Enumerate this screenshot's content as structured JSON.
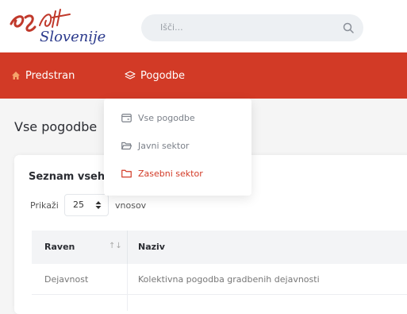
{
  "brand": {
    "logo_numeral": "30 let",
    "logo_word": "Slovenije",
    "logo_color": "#c0392b"
  },
  "search": {
    "placeholder": "Išči..."
  },
  "nav": {
    "home_label": "Predstran",
    "contracts_label": "Pogodbe",
    "background_color": "#d23a26"
  },
  "dropdown": {
    "items": [
      {
        "label": "Vse pogodbe",
        "icon": "card-icon",
        "active": false
      },
      {
        "label": "Javni sektor",
        "icon": "folder-open-icon",
        "active": false
      },
      {
        "label": "Zasebni sektor",
        "icon": "folder-icon",
        "active": true
      }
    ]
  },
  "main": {
    "page_title": "Vse pogodbe",
    "card_title": "Seznam vseh",
    "show_label": "Prikaži",
    "entries_value": "25",
    "entries_label": "vnosov",
    "table": {
      "headers": [
        "Raven",
        "Naziv"
      ],
      "rows": [
        {
          "raven": "Dejavnost",
          "naziv": "Kolektivna pogodba gradbenih dejavnosti"
        }
      ]
    }
  }
}
